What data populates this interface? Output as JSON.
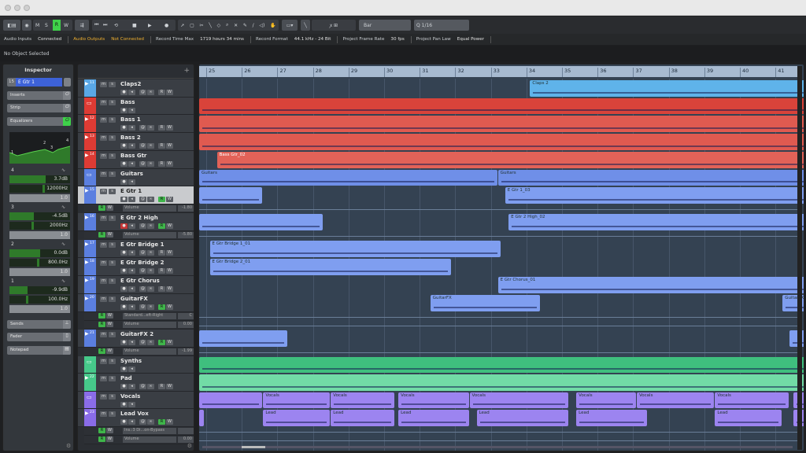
{
  "toolbar": {
    "mode_buttons": [
      "M",
      "S",
      "R",
      "W"
    ],
    "grid_type": "Bar",
    "quantize": "1/16",
    "tools_icons": [
      "object-select-icon",
      "range-icon",
      "split-icon",
      "glue-icon",
      "erase-icon",
      "zoom-icon",
      "mute-icon",
      "draw-icon",
      "line-icon",
      "play-icon",
      "comp-icon"
    ]
  },
  "status": {
    "audio_inputs_label": "Audio Inputs",
    "audio_inputs_value": "Connected",
    "audio_outputs_label": "Audio Outputs",
    "audio_outputs_value": "Not Connected",
    "record_time_label": "Record Time Max",
    "record_time_value": "1719 hours 34 mins",
    "record_format_label": "Record Format",
    "record_format_value": "44.1 kHz - 24 Bit",
    "frame_rate_label": "Project Frame Rate",
    "frame_rate_value": "30 fps",
    "pan_law_label": "Project Pan Law",
    "pan_law_value": "Equal Power",
    "colors": {
      "ok": "#c9cdd1",
      "warn": "#f0b030"
    }
  },
  "info_line": "No Object Selected",
  "inspector": {
    "title": "Inspector",
    "track_number": "15",
    "track_name": "E Gtr 1",
    "sections": {
      "inserts": "Inserts",
      "strip": "Strip",
      "equalizers": "Equalizers",
      "sends": "Sends",
      "fader": "Fader",
      "notepad": "Notepad"
    },
    "eq_graph_points": [
      "1",
      "2",
      "3",
      "4"
    ],
    "bands": [
      {
        "band": "4",
        "gain": "3.7dB",
        "freq": "12000Hz",
        "q": "1.0",
        "gain_level": 0.6
      },
      {
        "band": "3",
        "gain": "-4.5dB",
        "freq": "2000Hz",
        "q": "1.0",
        "gain_level": 0.4
      },
      {
        "band": "2",
        "gain": "0.0dB",
        "freq": "800.0Hz",
        "q": "1.0",
        "gain_level": 0.5
      },
      {
        "band": "1",
        "gain": "-9.9dB",
        "freq": "100.0Hz",
        "q": "1.0",
        "gain_level": 0.3
      }
    ]
  },
  "ruler": {
    "bars": [
      "25",
      "26",
      "27",
      "28",
      "29",
      "30",
      "31",
      "32",
      "33",
      "34",
      "35",
      "36",
      "37",
      "38",
      "39",
      "40",
      "41"
    ]
  },
  "tracks": [
    {
      "num": "11",
      "name": "Claps2",
      "color": "#5aa8e6",
      "type": "track",
      "regions": [
        {
          "label": "Claps 2",
          "start": 34.1,
          "end": 42.3,
          "color": "#5fb3ea"
        }
      ]
    },
    {
      "num": "",
      "name": "Bass",
      "color": "#de3b34",
      "type": "folder",
      "regions": [
        {
          "label": "",
          "start": 24.8,
          "end": 42.3,
          "color": "#d9433a"
        }
      ]
    },
    {
      "num": "12",
      "name": "Bass 1",
      "color": "#de3b34",
      "type": "track",
      "regions": [
        {
          "label": "",
          "start": 24.8,
          "end": 42.3,
          "color": "#e05a50"
        }
      ]
    },
    {
      "num": "13",
      "name": "Bass 2",
      "color": "#de3b34",
      "type": "track",
      "regions": [
        {
          "label": "",
          "start": 24.8,
          "end": 42.3,
          "color": "#e05a50"
        }
      ]
    },
    {
      "num": "14",
      "name": "Bass Gtr",
      "color": "#de3b34",
      "type": "track",
      "regions": [
        {
          "label": "Bass Gtr_02",
          "start": 25.3,
          "end": 42.3,
          "color": "#e26258"
        }
      ]
    },
    {
      "num": "",
      "name": "Guitars",
      "color": "#5b7fe0",
      "type": "folder",
      "regions": [
        {
          "label": "Guitars",
          "start": 24.8,
          "end": 33.2,
          "color": "#6f8fe8"
        },
        {
          "label": "Guitars",
          "start": 33.2,
          "end": 42.3,
          "color": "#6f8fe8"
        }
      ]
    },
    {
      "num": "15",
      "name": "E Gtr 1",
      "color": "#5b7fe0",
      "type": "track",
      "selected": true,
      "lanes": [
        {
          "label": "Volume",
          "value": "-1.80"
        }
      ],
      "regions": [
        {
          "label": "",
          "start": 24.8,
          "end": 26.6,
          "color": "#7f9ef0"
        },
        {
          "label": "E Gtr 1_03",
          "start": 33.4,
          "end": 42.3,
          "color": "#7f9ef0"
        }
      ]
    },
    {
      "num": "16",
      "name": "E Gtr 2 High",
      "color": "#5b7fe0",
      "type": "track",
      "rec": true,
      "lanes": [
        {
          "label": "Volume",
          "value": "-5.80"
        }
      ],
      "regions": [
        {
          "label": "",
          "start": 24.8,
          "end": 28.3,
          "color": "#7f9ef0"
        },
        {
          "label": "E Gtr 2 High_02",
          "start": 33.5,
          "end": 42.3,
          "color": "#7f9ef0"
        }
      ]
    },
    {
      "num": "17",
      "name": "E Gtr Bridge 1",
      "color": "#5b7fe0",
      "type": "track",
      "regions": [
        {
          "label": "E Gtr Bridge 1_01",
          "start": 25.1,
          "end": 33.3,
          "color": "#7f9ef0"
        }
      ]
    },
    {
      "num": "18",
      "name": "E Gtr Bridge 2",
      "color": "#5b7fe0",
      "type": "track",
      "regions": [
        {
          "label": "E Gtr Bridge 2_01",
          "start": 25.1,
          "end": 31.9,
          "color": "#7f9ef0"
        }
      ]
    },
    {
      "num": "19",
      "name": "E Gtr Chorus",
      "color": "#5b7fe0",
      "type": "track",
      "regions": [
        {
          "label": "E Gtr Chorus_01",
          "start": 33.2,
          "end": 42.3,
          "color": "#7f9ef0"
        }
      ]
    },
    {
      "num": "20",
      "name": "GuitarFX",
      "color": "#5b7fe0",
      "type": "track",
      "lanes": [
        {
          "label": "Standard...eft-Right",
          "value": "C"
        },
        {
          "label": "Volume",
          "value": "0.00"
        }
      ],
      "regions": [
        {
          "label": "GuitarFX",
          "start": 31.3,
          "end": 34.4,
          "color": "#7f9ef0"
        },
        {
          "label": "GuitarFX",
          "start": 41.2,
          "end": 42.3,
          "color": "#7f9ef0"
        }
      ]
    },
    {
      "num": "21",
      "name": "GuitarFX 2",
      "color": "#5b7fe0",
      "type": "track",
      "lanes": [
        {
          "label": "Volume",
          "value": "-1.99"
        }
      ],
      "regions": [
        {
          "label": "",
          "start": 24.8,
          "end": 27.3,
          "color": "#7f9ef0"
        },
        {
          "label": "",
          "start": 41.4,
          "end": 42.3,
          "color": "#7f9ef0"
        }
      ]
    },
    {
      "num": "",
      "name": "Synths",
      "color": "#46c98a",
      "type": "folder",
      "regions": [
        {
          "label": "",
          "start": 24.8,
          "end": 42.3,
          "color": "#3fbf7e"
        }
      ]
    },
    {
      "num": "22",
      "name": "Pad",
      "color": "#46c98a",
      "type": "track",
      "regions": [
        {
          "label": "",
          "start": 24.8,
          "end": 42.3,
          "color": "#72dba6"
        }
      ]
    },
    {
      "num": "",
      "name": "Vocals",
      "color": "#8a6ce8",
      "type": "folder",
      "regions": [
        {
          "label": "",
          "start": 24.8,
          "end": 26.6,
          "color": "#9c84f0"
        },
        {
          "label": "Vocals",
          "start": 26.6,
          "end": 28.5,
          "color": "#9c84f0"
        },
        {
          "label": "Vocals",
          "start": 28.5,
          "end": 30.3,
          "color": "#9c84f0"
        },
        {
          "label": "Vocals",
          "start": 30.4,
          "end": 32.4,
          "color": "#9c84f0"
        },
        {
          "label": "Vocals",
          "start": 32.4,
          "end": 35.2,
          "color": "#9c84f0"
        },
        {
          "label": "Vocals",
          "start": 35.4,
          "end": 37.1,
          "color": "#9c84f0"
        },
        {
          "label": "Vocals",
          "start": 37.1,
          "end": 39.3,
          "color": "#9c84f0"
        },
        {
          "label": "Vocals",
          "start": 39.3,
          "end": 41.4,
          "color": "#9c84f0"
        },
        {
          "label": "",
          "start": 41.5,
          "end": 42.3,
          "color": "#9c84f0"
        }
      ]
    },
    {
      "num": "23",
      "name": "Lead Vox",
      "color": "#8a6ce8",
      "type": "track",
      "lanes": [
        {
          "label": "Ins.:3 Di...on-Bypass",
          "value": ""
        },
        {
          "label": "Volume",
          "value": "0.00"
        }
      ],
      "regions": [
        {
          "label": "",
          "start": 24.8,
          "end": 24.95,
          "color": "#9c84f0"
        },
        {
          "label": "Lead",
          "start": 26.6,
          "end": 28.5,
          "color": "#9c84f0"
        },
        {
          "label": "Lead",
          "start": 28.5,
          "end": 30.3,
          "color": "#9c84f0"
        },
        {
          "label": "Lead",
          "start": 30.4,
          "end": 32.4,
          "color": "#9c84f0"
        },
        {
          "label": "Lead",
          "start": 32.6,
          "end": 35.2,
          "color": "#9c84f0"
        },
        {
          "label": "Lead",
          "start": 35.4,
          "end": 37.4,
          "color": "#9c84f0"
        },
        {
          "label": "Lead",
          "start": 39.3,
          "end": 41.2,
          "color": "#9c84f0"
        },
        {
          "label": "",
          "start": 41.5,
          "end": 42.3,
          "color": "#9c84f0"
        }
      ]
    }
  ]
}
